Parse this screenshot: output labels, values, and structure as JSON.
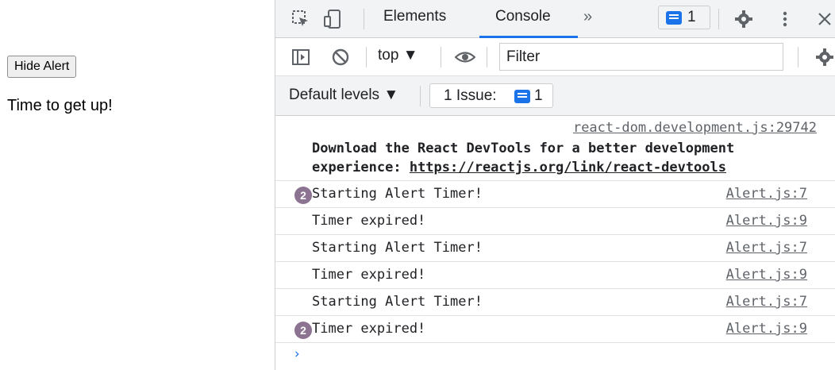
{
  "page": {
    "hide_button": "Hide Alert",
    "alert_text": "Time to get up!"
  },
  "devtools": {
    "tabs": [
      "Elements",
      "Console"
    ],
    "active_tab": "Console",
    "more_tabs": "»",
    "issue_badge_count": "1",
    "context_selector": "top ▼",
    "filter_placeholder": "Filter",
    "levels_label": "Default levels ▼",
    "issues_label": "1 Issue:",
    "issues_count": "1",
    "accent_color": "#1a73e8",
    "icons": [
      "inspect-icon",
      "device-icon",
      "issues-message-icon",
      "gear-icon",
      "more-vert-icon",
      "close-icon",
      "sidebar-icon",
      "clear-icon",
      "eye-icon"
    ]
  },
  "console": {
    "intro_source": "react-dom.development.js:29742",
    "intro_line1": "Download the React DevTools for a better development",
    "intro_line2_prefix": "experience: ",
    "intro_link": "https://reactjs.org/link/react-devtools",
    "messages": [
      {
        "count": "2",
        "text": "Starting Alert Timer!",
        "source": "Alert.js:7"
      },
      {
        "count": "",
        "text": "Timer expired!",
        "source": "Alert.js:9"
      },
      {
        "count": "",
        "text": "Starting Alert Timer!",
        "source": "Alert.js:7"
      },
      {
        "count": "",
        "text": "Timer expired!",
        "source": "Alert.js:9"
      },
      {
        "count": "",
        "text": "Starting Alert Timer!",
        "source": "Alert.js:7"
      },
      {
        "count": "2",
        "text": "Timer expired!",
        "source": "Alert.js:9"
      }
    ],
    "prompt": "›"
  }
}
